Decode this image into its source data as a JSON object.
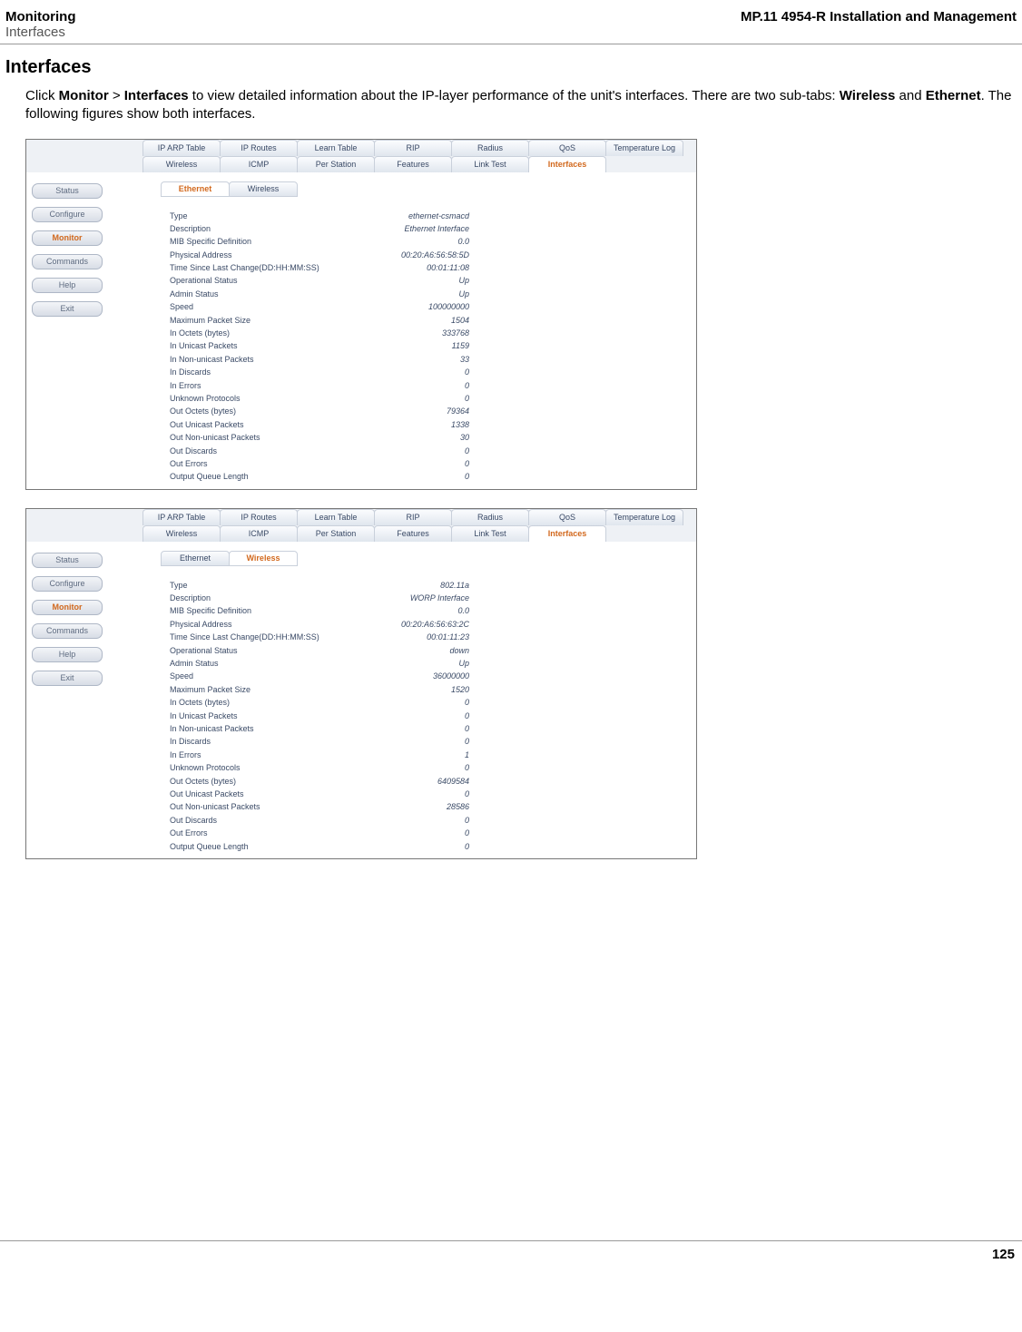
{
  "header": {
    "left_line1": "Monitoring",
    "left_line2": "Interfaces",
    "right": "MP.11 4954-R Installation and Management"
  },
  "section_title": "Interfaces",
  "intro_parts": {
    "p1": "Click ",
    "b1": "Monitor",
    "p2": " > ",
    "b2": "Interfaces",
    "p3": " to view detailed information about the IP-layer performance of the unit's interfaces. There are two sub-tabs: ",
    "b3": "Wireless",
    "p4": " and ",
    "b4": "Ethernet",
    "p5": ". The following figures show both interfaces."
  },
  "tabs_row1": [
    "IP ARP Table",
    "IP Routes",
    "Learn Table",
    "RIP",
    "Radius",
    "QoS",
    "Temperature Log"
  ],
  "tabs_row2": [
    "Wireless",
    "ICMP",
    "Per Station",
    "Features",
    "Link Test",
    "Interfaces"
  ],
  "sidebar": [
    "Status",
    "Configure",
    "Monitor",
    "Commands",
    "Help",
    "Exit"
  ],
  "sidebar_active_index": 2,
  "fig1": {
    "subtabs": [
      "Ethernet",
      "Wireless"
    ],
    "active_sub": 0,
    "rows": [
      {
        "k": "Type",
        "v": "ethernet-csmacd"
      },
      {
        "k": "Description",
        "v": "Ethernet Interface"
      },
      {
        "k": "MIB Specific Definition",
        "v": "0.0"
      },
      {
        "k": "Physical Address",
        "v": "00:20:A6:56:58:5D"
      },
      {
        "k": "Time Since Last Change(DD:HH:MM:SS)",
        "v": "00:01:11:08"
      },
      {
        "k": "Operational Status",
        "v": "Up"
      },
      {
        "k": "Admin Status",
        "v": "Up"
      },
      {
        "k": "Speed",
        "v": "100000000"
      },
      {
        "k": "Maximum Packet Size",
        "v": "1504"
      },
      {
        "k": "In Octets (bytes)",
        "v": "333768"
      },
      {
        "k": "In Unicast Packets",
        "v": "1159"
      },
      {
        "k": "In Non-unicast Packets",
        "v": "33"
      },
      {
        "k": "In Discards",
        "v": "0"
      },
      {
        "k": "In Errors",
        "v": "0"
      },
      {
        "k": "Unknown Protocols",
        "v": "0"
      },
      {
        "k": "Out Octets (bytes)",
        "v": "79364"
      },
      {
        "k": "Out Unicast Packets",
        "v": "1338"
      },
      {
        "k": "Out Non-unicast Packets",
        "v": "30"
      },
      {
        "k": "Out Discards",
        "v": "0"
      },
      {
        "k": "Out Errors",
        "v": "0"
      },
      {
        "k": "Output Queue Length",
        "v": "0"
      }
    ]
  },
  "fig2": {
    "subtabs": [
      "Ethernet",
      "Wireless"
    ],
    "active_sub": 1,
    "rows": [
      {
        "k": "Type",
        "v": "802.11a"
      },
      {
        "k": "Description",
        "v": "WORP Interface"
      },
      {
        "k": "MIB Specific Definition",
        "v": "0.0"
      },
      {
        "k": "Physical Address",
        "v": "00:20:A6:56:63:2C"
      },
      {
        "k": "Time Since Last Change(DD:HH:MM:SS)",
        "v": "00:01:11:23"
      },
      {
        "k": "Operational Status",
        "v": "down"
      },
      {
        "k": "Admin Status",
        "v": "Up"
      },
      {
        "k": "Speed",
        "v": "36000000"
      },
      {
        "k": "Maximum Packet Size",
        "v": "1520"
      },
      {
        "k": "In Octets (bytes)",
        "v": "0"
      },
      {
        "k": "In Unicast Packets",
        "v": "0"
      },
      {
        "k": "In Non-unicast Packets",
        "v": "0"
      },
      {
        "k": "In Discards",
        "v": "0"
      },
      {
        "k": "In Errors",
        "v": "1"
      },
      {
        "k": "Unknown Protocols",
        "v": "0"
      },
      {
        "k": "Out Octets (bytes)",
        "v": "6409584"
      },
      {
        "k": "Out Unicast Packets",
        "v": "0"
      },
      {
        "k": "Out Non-unicast Packets",
        "v": "28586"
      },
      {
        "k": "Out Discards",
        "v": "0"
      },
      {
        "k": "Out Errors",
        "v": "0"
      },
      {
        "k": "Output Queue Length",
        "v": "0"
      }
    ]
  },
  "page_number": "125"
}
